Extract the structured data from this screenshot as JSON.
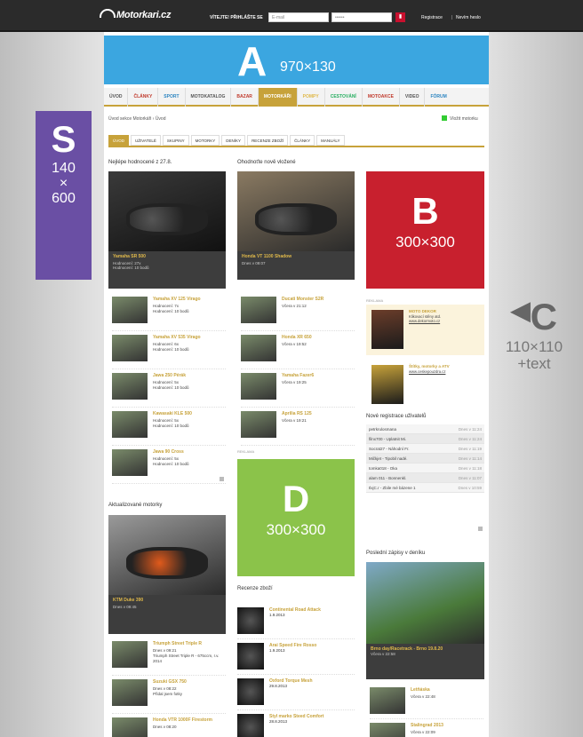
{
  "header": {
    "logo": "Motorkari.cz",
    "login_label": "VÍTEJTE! PŘIHLÁŠTE SE",
    "email_placeholder": "E-mail",
    "password_placeholder": "••••••",
    "register": "Registrace",
    "forgot": "Nevím heslo"
  },
  "banner_a": {
    "letter": "A",
    "size": "970×130"
  },
  "nav": [
    "ÚVOD",
    "ČLÁNKY",
    "SPORT",
    "MOTOKATALOG",
    "BAZAR",
    "MOTORKÁŘI",
    "POMPY",
    "CESTOVÁNÍ",
    "MOTOAKCE",
    "VIDEO",
    "FÓRUM"
  ],
  "breadcrumb": {
    "part1": "Úvod sekce Motorkáři",
    "sep": "›",
    "part2": "Úvod"
  },
  "add_link": "Vložit motorku",
  "subtabs": [
    "ÚVOD",
    "UŽIVATELÉ",
    "SKUPINY",
    "MOTORKY",
    "DENÍKY",
    "RECENZE ZBOŽÍ",
    "ČLÁNKY",
    "MANUÁLY"
  ],
  "col1": {
    "title": "Nejlépe hodnocené z 27.8.",
    "feature": {
      "title": "Yamaha SR 500",
      "line1": "Hodnocení: 27x",
      "line2": "Hodnocení: 10 bodů"
    },
    "items": [
      {
        "title": "Yamaha XV 125 Virago",
        "l1": "Hodnocení: 7x",
        "l2": "Hodnocení: 10 bodů"
      },
      {
        "title": "Yamaha XV 535 Virago",
        "l1": "Hodnocení: 6x",
        "l2": "Hodnocení: 10 bodů"
      },
      {
        "title": "Jawa 250 Pérák",
        "l1": "Hodnocení: 5x",
        "l2": "Hodnocení: 10 bodů"
      },
      {
        "title": "Kawasaki KLE 500",
        "l1": "Hodnocení: 5x",
        "l2": "Hodnocení: 10 bodů"
      },
      {
        "title": "Jawa 90 Cross",
        "l1": "Hodnocení: 5x",
        "l2": "Hodnocení: 10 bodů"
      }
    ],
    "updated_title": "Aktualizované motorky",
    "updated_feature": {
      "title": "KTM Duke 390",
      "line1": "Dnes v 09:45"
    },
    "updated_items": [
      {
        "title": "Triumph Street Triple R",
        "l1": "Dnes v 09:21",
        "l2": "Triumph Street Triple R - 675ccm, r.v. 2014"
      },
      {
        "title": "Suzuki GSX 750",
        "l1": "Dnes v 08:22",
        "l2": "Přidal jsem fotky"
      },
      {
        "title": "Honda VTR 1000F Firestorm",
        "l1": "Dnes v 08:20",
        "l2": ""
      }
    ]
  },
  "col2": {
    "title": "Ohodnoťte nově vložené",
    "feature": {
      "title": "Honda VT 1100 Shadow",
      "line1": "Dnes v 09:07"
    },
    "items": [
      {
        "title": "Ducati Monster S2R",
        "l1": "Včera v 21:12",
        "l2": ""
      },
      {
        "title": "Honda XR 650",
        "l1": "Včera v 19:52",
        "l2": ""
      },
      {
        "title": "Yamaha Fazer6",
        "l1": "Včera v 19:25",
        "l2": ""
      },
      {
        "title": "Aprilia RS 125",
        "l1": "Včera v 19:21",
        "l2": ""
      }
    ],
    "ad_label": "REKLAMA",
    "reviews_title": "Recenze zboží",
    "reviews": [
      {
        "title": "Continental Road Attack",
        "l1": "1.9.2013",
        "l2": ""
      },
      {
        "title": "Arai Speed Fire Rosso",
        "l1": "1.9.2013",
        "l2": ""
      },
      {
        "title": "Oxford Torque Mesh",
        "l1": "29.8.2013",
        "l2": ""
      },
      {
        "title": "Styl marko Steed Comfort",
        "l1": "28.8.2013",
        "l2": ""
      }
    ]
  },
  "col3": {
    "ad_label": "REKLAMA",
    "ads": [
      {
        "title": "MOTO DEKOR",
        "text": "Klikovací stěny atd.",
        "link": "www.dekormoto.cz"
      },
      {
        "title": "Štítky, motorky a ATV",
        "text": "",
        "link": "www.ceskepouzdra.cz"
      }
    ],
    "reg_title": "Nové registrace uživatelů",
    "registrations": [
      {
        "name": "petrkrulosmana",
        "date": "Dnes v 11:24"
      },
      {
        "name": "filnx700 - Uplatnit Mi.",
        "date": "Dnes v 11:24"
      },
      {
        "name": "Socrat27 - Náhodní Fr.",
        "date": "Dnes v 11:19"
      },
      {
        "name": "Mičkjet - Tipobil nadé.",
        "date": "Dnes v 11:14"
      },
      {
        "name": "tomka018 - Oka",
        "date": "Dnes v 11:18"
      },
      {
        "name": "alam 011 - Bonnenkl.",
        "date": "Dnes v 11:07"
      },
      {
        "name": "IlxjC.r - Zbile mé bázene 1",
        "date": "Dnes v 10:59"
      }
    ],
    "diary_title": "Poslední zápisy v deníku",
    "diary_feature": {
      "title": "Brno day/Racetrack - Brno 19.8.20",
      "line1": "Včera v 22:58"
    },
    "diary_items": [
      {
        "title": "Letňáska",
        "l1": "Včera v 22:48"
      },
      {
        "title": "Stalingrad 2013",
        "l1": "Včera v 22:09"
      }
    ]
  },
  "banners": {
    "b": {
      "letter": "B",
      "size": "300×300"
    },
    "d": {
      "letter": "D",
      "size": "300×300"
    },
    "s": {
      "letter": "S",
      "size_l1": "140",
      "size_l2": "×",
      "size_l3": "600"
    },
    "c": {
      "letter": "C",
      "size_l1": "110×110",
      "size_l2": "+text"
    }
  },
  "colors": {
    "accent": "#c7a23a",
    "a": "#3ba6e0",
    "b": "#c8202e",
    "d": "#8bc34a",
    "s": "#6a4fa4"
  }
}
